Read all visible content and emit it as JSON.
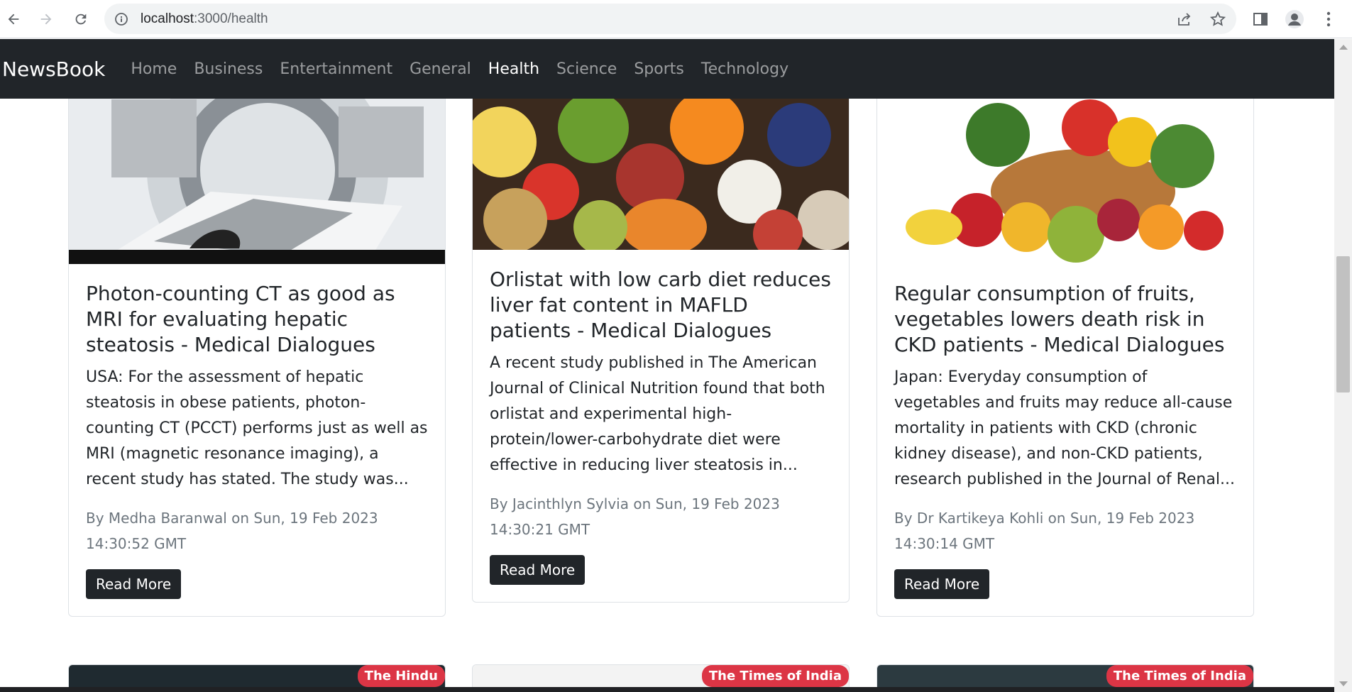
{
  "browser": {
    "url_host": "localhost",
    "url_path": ":3000/health"
  },
  "navbar": {
    "brand": "NewsBook",
    "links": [
      "Home",
      "Business",
      "Entertainment",
      "General",
      "Health",
      "Science",
      "Sports",
      "Technology"
    ],
    "active": "Health"
  },
  "cards": [
    {
      "title": "Photon-counting CT as good as MRI for evaluating hepatic steatosis - Medical Dialogues",
      "description": "USA: For the assessment of hepatic steatosis in obese patients, photon-counting CT (PCCT) performs just as well as MRI (magnetic resonance imaging), a recent study has stated. The study was...",
      "meta": "By Medha Baranwal on Sun, 19 Feb 2023 14:30:52 GMT",
      "button": "Read More",
      "image": "ct-scanner-image"
    },
    {
      "title": "Orlistat with low carb diet reduces liver fat content in MAFLD patients - Medical Dialogues",
      "description": "A recent study published in The American Journal of Clinical Nutrition found that both orlistat and experimental high-protein/lower-carbohydrate diet were effective in reducing liver steatosis in...",
      "meta": "By Jacinthlyn Sylvia on Sun, 19 Feb 2023 14:30:21 GMT",
      "button": "Read More",
      "image": "fruits-grains-image"
    },
    {
      "title": "Regular consumption of fruits, vegetables lowers death risk in CKD patients - Medical Dialogues",
      "description": "Japan: Everyday consumption of vegetables and fruits may reduce all-cause mortality in patients with CKD (chronic kidney disease), and non-CKD patients, research published in the Journal of Renal...",
      "meta": "By Dr Kartikeya Kohli on Sun, 19 Feb 2023 14:30:14 GMT",
      "button": "Read More",
      "image": "vegetable-basket-image"
    }
  ],
  "next_row_badges": [
    "The Hindu",
    "The Times of India",
    "The Times of India"
  ],
  "colors": {
    "navbar_bg": "#212529",
    "badge_bg": "#dc3545",
    "button_bg": "#212529"
  }
}
